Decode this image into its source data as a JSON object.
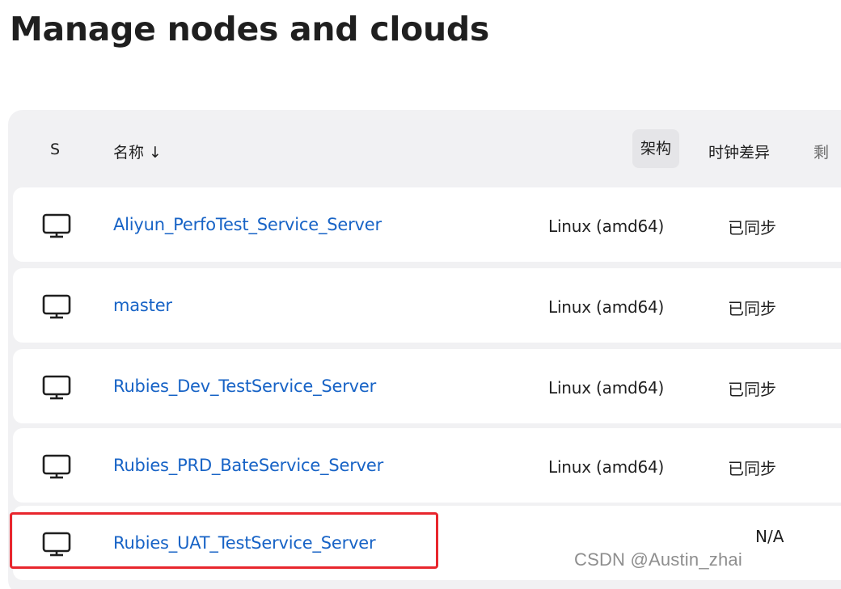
{
  "page": {
    "title": "Manage nodes and clouds"
  },
  "table": {
    "headers": {
      "status": "S",
      "name": "名称 ↓",
      "arch": "架构",
      "clock": "时钟差异",
      "more": "剩"
    },
    "rows": [
      {
        "icon": "computer-icon",
        "name": "Aliyun_PerfoTest_Service_Server",
        "arch": "Linux (amd64)",
        "clock": "已同步"
      },
      {
        "icon": "computer-icon",
        "name": "master",
        "arch": "Linux (amd64)",
        "clock": "已同步"
      },
      {
        "icon": "computer-icon",
        "name": "Rubies_Dev_TestService_Server",
        "arch": "Linux (amd64)",
        "clock": "已同步"
      },
      {
        "icon": "computer-icon",
        "name": "Rubies_PRD_BateService_Server",
        "arch": "Linux (amd64)",
        "clock": "已同步"
      },
      {
        "icon": "computer-icon",
        "name": "Rubies_UAT_TestService_Server",
        "arch": "",
        "clock": "N/A"
      }
    ]
  },
  "colors": {
    "link": "#1763c6",
    "highlight": "#e8262d",
    "card_bg": "#f1f1f3"
  },
  "watermark": "CSDN @Austin_zhai"
}
